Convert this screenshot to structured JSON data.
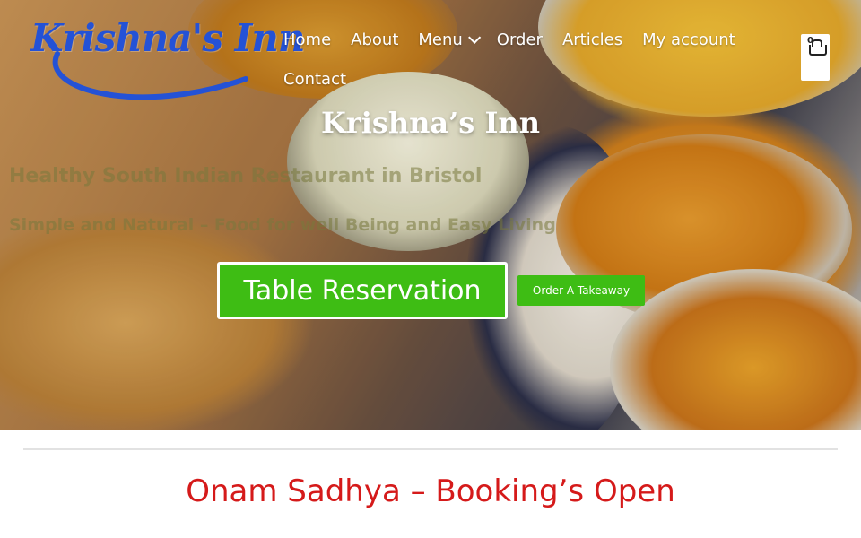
{
  "brand": {
    "logo_text": "Krishna's Inn",
    "logo_color": "#2452d6"
  },
  "nav": {
    "items": [
      {
        "label": "Home"
      },
      {
        "label": "About"
      },
      {
        "label": "Menu",
        "has_dropdown": true
      },
      {
        "label": "Order"
      },
      {
        "label": "Articles"
      },
      {
        "label": "My account"
      },
      {
        "label": "Contact"
      }
    ]
  },
  "cart": {
    "count": "0",
    "icon": "basket-icon"
  },
  "hero": {
    "title": "Krishna’s Inn",
    "subtitle1": "Healthy South Indian Restaurant in Bristol",
    "subtitle2": "Simple and Natural – Food for well Being and Easy Living",
    "primary_button": "Table Reservation",
    "secondary_button": "Order A Takeaway",
    "button_color": "#3ebd14"
  },
  "section": {
    "title": "Onam Sadhya – Booking’s Open",
    "title_color": "#d51a1a"
  }
}
